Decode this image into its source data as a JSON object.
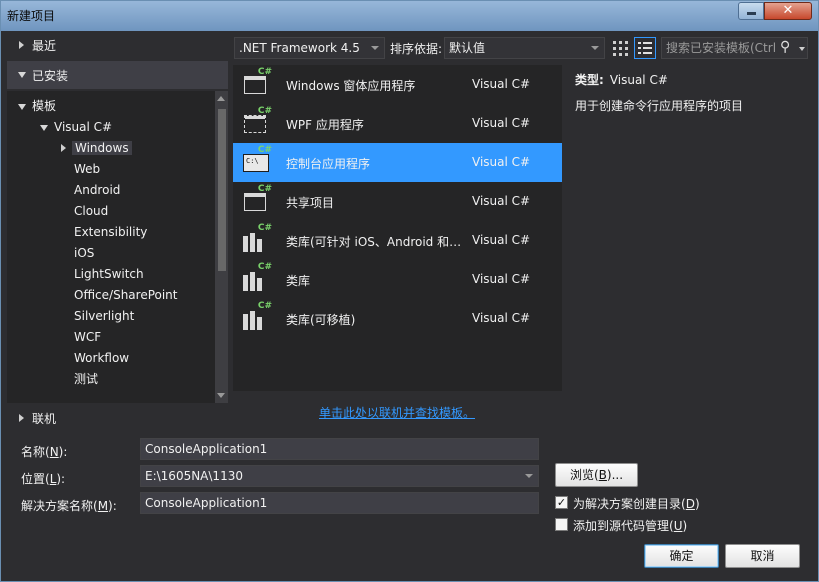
{
  "window": {
    "title": "新建项目",
    "close_glyph": "✕"
  },
  "nav": {
    "recent": "最近",
    "installed": "已安装",
    "online": "联机",
    "tree": [
      {
        "label": "模板"
      },
      {
        "label": "Visual C#"
      },
      {
        "label": "Windows"
      },
      {
        "label": "Web"
      },
      {
        "label": "Android"
      },
      {
        "label": "Cloud"
      },
      {
        "label": "Extensibility"
      },
      {
        "label": "iOS"
      },
      {
        "label": "LightSwitch"
      },
      {
        "label": "Office/SharePoint"
      },
      {
        "label": "Silverlight"
      },
      {
        "label": "WCF"
      },
      {
        "label": "Workflow"
      },
      {
        "label": "测试"
      }
    ]
  },
  "toolbar": {
    "framework": ".NET Framework 4.5",
    "sort_label": "排序依据:",
    "sort_value": "默认值",
    "search_placeholder": "搜索已安装模板(Ctrl",
    "search_glyph": "⚲"
  },
  "templates": [
    {
      "name": "Windows 窗体应用程序",
      "lang": "Visual C#",
      "icon": "windows-form-icon",
      "selected": false
    },
    {
      "name": "WPF 应用程序",
      "lang": "Visual C#",
      "icon": "wpf-icon",
      "selected": false
    },
    {
      "name": "控制台应用程序",
      "lang": "Visual C#",
      "icon": "console-icon",
      "selected": true
    },
    {
      "name": "共享项目",
      "lang": "Visual C#",
      "icon": "shared-project-icon",
      "selected": false
    },
    {
      "name": "类库(可针对 iOS、Android 和…",
      "lang": "Visual C#",
      "icon": "class-library-icon",
      "selected": false
    },
    {
      "name": "类库",
      "lang": "Visual C#",
      "icon": "class-library-icon",
      "selected": false
    },
    {
      "name": "类库(可移植)",
      "lang": "Visual C#",
      "icon": "class-library-icon",
      "selected": false
    }
  ],
  "template_badge": "C#",
  "console_glyph": "C:\\",
  "online_link": "单击此处以联机并查找模板。",
  "details": {
    "type_label": "类型:",
    "type_value": "Visual C#",
    "description": "用于创建命令行应用程序的项目"
  },
  "form": {
    "name_label_pre": "名称(",
    "name_label_key": "N",
    "name_label_post": "):",
    "name_value": "ConsoleApplication1",
    "location_label_pre": "位置(",
    "location_label_key": "L",
    "location_label_post": "):",
    "location_value": "E:\\1605NA\\1130",
    "solution_label_pre": "解决方案名称(",
    "solution_label_key": "M",
    "solution_label_post": "):",
    "solution_value": "ConsoleApplication1",
    "browse_pre": "浏览(",
    "browse_key": "B",
    "browse_post": ")...",
    "create_dir_pre": "为解决方案创建目录(",
    "create_dir_key": "D",
    "create_dir_post": ")",
    "create_dir_checked": true,
    "check_glyph": "✓",
    "source_control_pre": "添加到源代码管理(",
    "source_control_key": "U",
    "source_control_post": ")",
    "source_control_checked": false,
    "ok": "确定",
    "cancel": "取消"
  },
  "colors": {
    "background": "#2d2d30",
    "panel": "#252526",
    "selection": "#3399ff",
    "link": "#3399ff"
  }
}
